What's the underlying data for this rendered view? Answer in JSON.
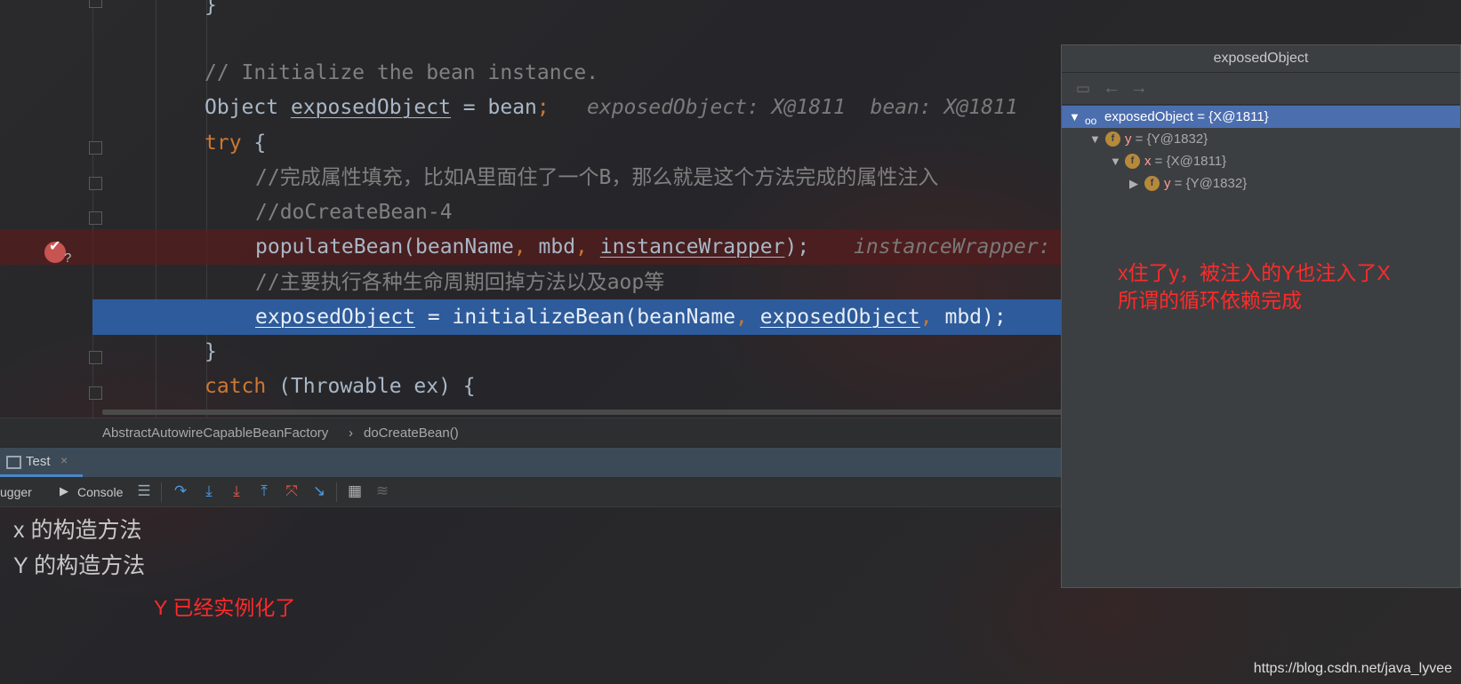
{
  "editor": {
    "lines": {
      "l0_brace": "}",
      "l2_comment": "// Initialize the bean instance.",
      "l3_type": "Object ",
      "l3_var": "exposedObject",
      "l3_eq": " = bean",
      "l3_semi": ";",
      "l3_hint": "exposedObject: X@1811  bean: X@1811",
      "l4_try": "try",
      "l4_brace": " {",
      "l5_comment": "//完成属性填充，比如A里面住了一个B，那么就是这个方法完成的属性注入",
      "l6_comment": "//doCreateBean-4",
      "l7_call": "populateBean(beanName",
      "l7_c1": ",",
      "l7_arg2": " mbd",
      "l7_c2": ",",
      "l7_sp": " ",
      "l7_arg3": "instanceWrapper",
      "l7_end": ");",
      "l7_hint": "instanceWrapper: \"BeanWrapperImpl\"",
      "l8_comment": "//主要执行各种生命周期回掉方法以及aop等",
      "l9_var": "exposedObject",
      "l9_mid": " = initializeBean(beanName",
      "l9_c1": ",",
      "l9_sp": " ",
      "l9_arg": "exposedObject",
      "l9_c2": ",",
      "l9_end": " mbd);",
      "l10_brace": "}",
      "l11_catch": "catch",
      "l11_rest": " (Throwable ex) {"
    }
  },
  "breadcrumb": {
    "class_name": "AbstractAutowireCapableBeanFactory",
    "separator": "›",
    "method_name": "doCreateBean()"
  },
  "debug": {
    "tab_label": "Test",
    "tab_close": "×",
    "debugger_label": "ugger",
    "console_label": "Console"
  },
  "console": {
    "line1": "x  的构造方法",
    "line2": "Y  的构造方法",
    "annotation": "Y 已经实例化了"
  },
  "popup": {
    "title": "exposedObject",
    "tree": [
      {
        "name": "exposedObject",
        "value": " = {X@1811}"
      },
      {
        "name": "y",
        "value": " = {Y@1832}"
      },
      {
        "name": "x",
        "value": " = {X@1811}"
      },
      {
        "name": "y",
        "value": " = {Y@1832}"
      }
    ],
    "annotation_line1": "x住了y，被注入的Y也注入了X",
    "annotation_line2": "所谓的循环依赖完成"
  },
  "watermark": "https://blog.csdn.net/java_lyvee",
  "colors": {
    "keyword": "#cc7832",
    "comment": "#808080",
    "execution_highlight": "#2d5b9b",
    "annotation": "#ff2a2a",
    "tree_selected": "#4b6eaf"
  }
}
